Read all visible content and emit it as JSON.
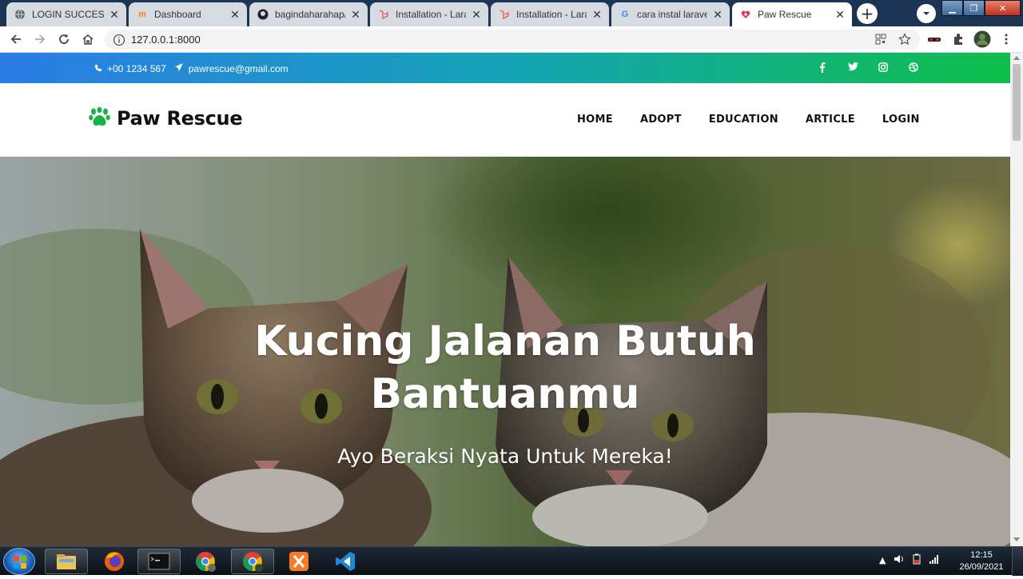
{
  "browser": {
    "tabs": [
      {
        "title": "LOGIN SUCCESS",
        "icon": "globe-icon",
        "active": false
      },
      {
        "title": "Dashboard",
        "icon": "moodle-icon",
        "active": false
      },
      {
        "title": "bagindaharahap/t",
        "icon": "github-icon",
        "active": false
      },
      {
        "title": "Installation - Larav",
        "icon": "laravel-icon",
        "active": false
      },
      {
        "title": "Installation - Larav",
        "icon": "laravel-icon",
        "active": false
      },
      {
        "title": "cara instal laravel",
        "icon": "google-icon",
        "active": false
      },
      {
        "title": "Paw Rescue",
        "icon": "paw-heart-icon",
        "active": true
      }
    ],
    "url": "127.0.0.1:8000"
  },
  "topbar": {
    "phone": "+00 1234 567",
    "email": "pawrescue@gmail.com",
    "social": [
      "facebook-icon",
      "twitter-icon",
      "instagram-icon",
      "dribbble-icon"
    ]
  },
  "navbar": {
    "brand": "Paw Rescue",
    "menu": [
      "HOME",
      "ADOPT",
      "EDUCATION",
      "ARTICLE",
      "LOGIN"
    ]
  },
  "hero": {
    "title_line1": "Kucing Jalanan Butuh",
    "title_line2": "Bantuanmu",
    "subtitle": "Ayo Beraksi Nyata Untuk Mereka!"
  },
  "taskbar": {
    "time": "12:15",
    "date": "26/09/2021"
  },
  "colors": {
    "topbar_start": "#2a7de6",
    "topbar_end": "#0fbf4a",
    "brand_paw": "#17b34a"
  }
}
